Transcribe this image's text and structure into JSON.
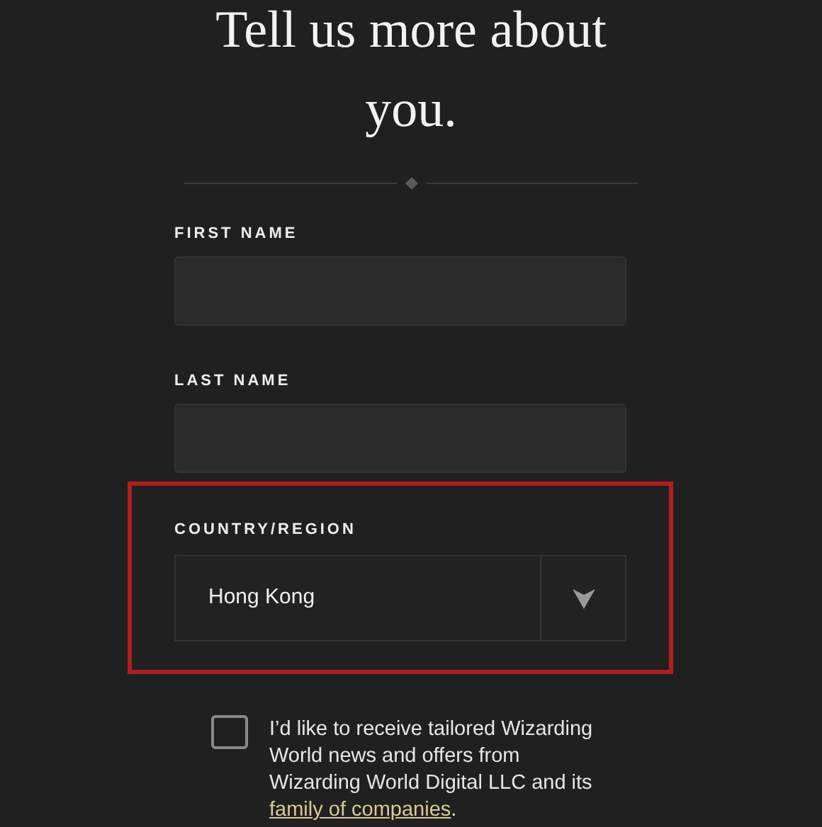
{
  "heading": "Tell us more about you.",
  "fields": [
    {
      "kind": "text",
      "label": "FIRST NAME"
    },
    {
      "kind": "text",
      "label": "LAST NAME"
    },
    {
      "kind": "select",
      "label": "COUNTRY/REGION",
      "value": "Hong Kong",
      "highlighted": true
    }
  ],
  "consent": {
    "checked": false,
    "text": "I’d like to receive tailored Wizarding World news and offers from Wizarding World Digital LLC and its",
    "link": "family of companies",
    "after": "."
  }
}
